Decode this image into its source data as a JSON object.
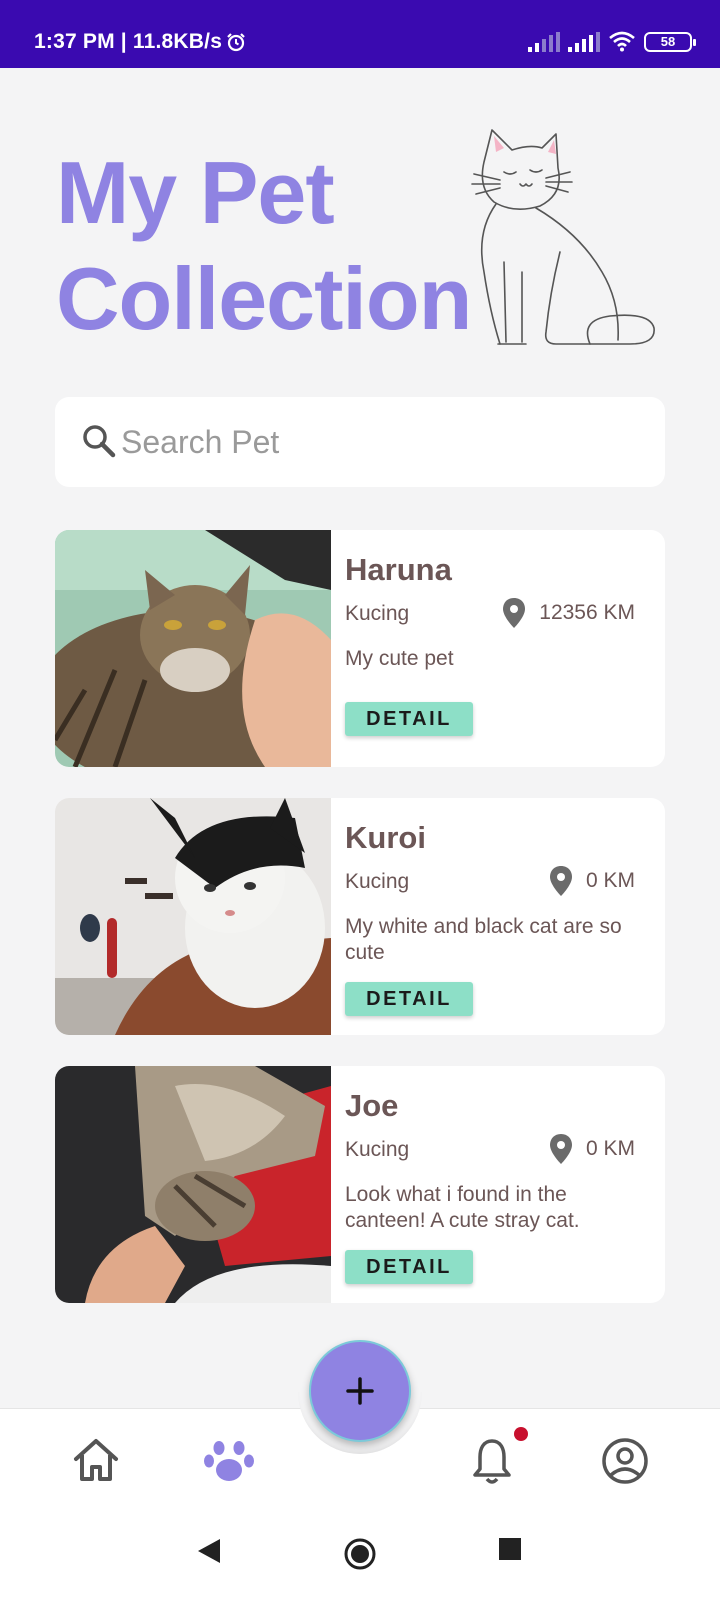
{
  "status_bar": {
    "time_speed": "1:37 PM | 11.8KB/s",
    "battery": "58",
    "icons": [
      "alarm-icon",
      "signal-icon",
      "signal-icon",
      "wifi-icon",
      "battery-icon"
    ]
  },
  "header": {
    "title_line1": "My Pet",
    "title_line2": "Collection",
    "title_color": "#8f83e2"
  },
  "search": {
    "placeholder": "Search Pet",
    "value": ""
  },
  "pets": [
    {
      "name": "Haruna",
      "type": "Kucing",
      "distance": "12356 KM",
      "description": "My cute pet",
      "button_label": "DETAIL"
    },
    {
      "name": "Kuroi",
      "type": "Kucing",
      "distance": "0 KM",
      "description": "My white and black cat are so cute",
      "button_label": "DETAIL"
    },
    {
      "name": "Joe",
      "type": "Kucing",
      "distance": "0 KM",
      "description": "Look what i found in the canteen! A cute stray cat.",
      "button_label": "DETAIL"
    }
  ],
  "bottom_nav": {
    "items": [
      "home-icon",
      "paw-icon",
      "add-icon",
      "bell-icon",
      "profile-icon"
    ],
    "active": "paw-icon",
    "accent": "#8f83e2",
    "button_color": "#8ddfc7"
  },
  "system_nav": [
    "back-icon",
    "home-circle-icon",
    "recents-icon"
  ]
}
